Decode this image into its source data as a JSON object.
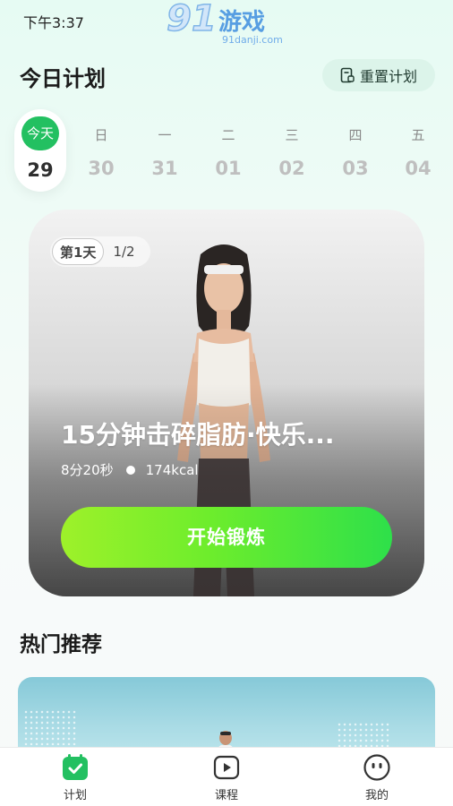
{
  "status_bar": {
    "time": "下午3:37"
  },
  "watermark": {
    "number": "91",
    "title": "游戏",
    "site": "91danji.com"
  },
  "header": {
    "title": "今日计划",
    "reset_label": "重置计划"
  },
  "week": [
    {
      "label": "今天",
      "date": "29",
      "selected": true
    },
    {
      "label": "日",
      "date": "30"
    },
    {
      "label": "一",
      "date": "31"
    },
    {
      "label": "二",
      "date": "01"
    },
    {
      "label": "三",
      "date": "02"
    },
    {
      "label": "四",
      "date": "03"
    },
    {
      "label": "五",
      "date": "04"
    }
  ],
  "workout": {
    "day_badge": "第1天",
    "progress": "1/2",
    "title": "15分钟击碎脂肪·快乐...",
    "duration": "8分20秒",
    "calories": "174kcal",
    "start_label": "开始锻炼"
  },
  "recommend": {
    "title": "热门推荐"
  },
  "tabbar": {
    "items": [
      {
        "label": "计划",
        "icon": "calendar-check-icon",
        "active": true
      },
      {
        "label": "课程",
        "icon": "play-icon"
      },
      {
        "label": "我的",
        "icon": "face-icon"
      }
    ]
  },
  "colors": {
    "accent_green": "#23c061",
    "button_start": "#9ef12a",
    "button_end": "#2ee04a"
  }
}
